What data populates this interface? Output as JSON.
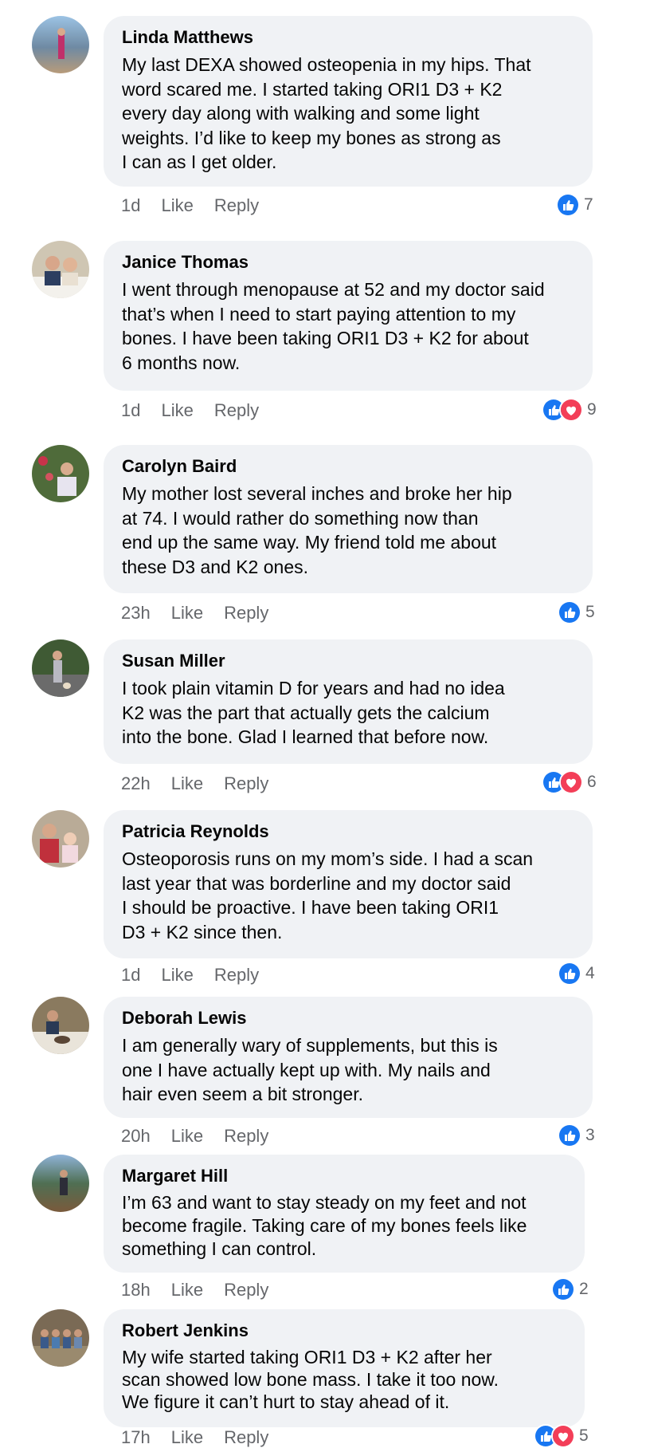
{
  "comments": [
    {
      "author": "Linda Matthews",
      "text": "My last DEXA showed osteopenia in my hips. That word scared me. I started taking ORI1 D3 + K2 every day along with walking and some light weights. I’d like to keep my bones as strong as I can as I get older.",
      "lines": [
        "My last DEXA showed osteopenia in my hips. That",
        "word scared me. I started taking ORI1 D3 + K2",
        "every day along with walking and some light",
        "weights. I’d like to keep my bones as strong as",
        "I can as I get older."
      ],
      "time": "1d",
      "like": "Like",
      "reply": "Reply",
      "reactions": [
        "like-icon"
      ],
      "count": "7"
    },
    {
      "author": "Janice Thomas",
      "text": "",
      "lines": [
        "I went through menopause at 52 and my doctor said",
        "that’s when I need to start paying attention to my",
        "bones. I have been taking ORI1 D3 + K2 for about",
        "6 months now."
      ],
      "time": "1d",
      "like": "Like",
      "reply": "Reply",
      "reactions": [
        "like-icon",
        "love-icon"
      ],
      "count": "9"
    },
    {
      "author": "Carolyn Baird",
      "text": "",
      "lines": [
        "My mother lost several inches and broke her hip",
        "at 74. I would rather do something now than",
        "end up the same way. My friend told me about",
        "these D3 and K2 ones."
      ],
      "time": "23h",
      "like": "Like",
      "reply": "Reply",
      "reactions": [
        "like-icon"
      ],
      "count": "5"
    },
    {
      "author": "Susan Miller",
      "text": "",
      "lines": [
        "I took plain vitamin D for years and had no idea",
        "K2 was the part that actually gets the calcium",
        "into the bone. Glad I learned that before now."
      ],
      "time": "22h",
      "like": "Like",
      "reply": "Reply",
      "reactions": [
        "like-icon",
        "love-icon"
      ],
      "count": "6"
    },
    {
      "author": "Patricia Reynolds",
      "text": "",
      "lines": [
        "Osteoporosis runs on my mom’s side. I had a scan",
        "last year that was borderline and my doctor said",
        "I should be proactive. I have been taking ORI1",
        "D3 + K2 since then."
      ],
      "time": "1d",
      "like": "Like",
      "reply": "Reply",
      "reactions": [
        "like-icon"
      ],
      "count": "4"
    },
    {
      "author": "Deborah Lewis",
      "text": "",
      "lines": [
        "I am generally wary of supplements, but this is",
        "one I have actually kept up with. My nails and",
        "hair even seem a bit stronger."
      ],
      "time": "20h",
      "like": "Like",
      "reply": "Reply",
      "reactions": [
        "like-icon"
      ],
      "count": "3"
    },
    {
      "author": "Margaret Hill",
      "text": "",
      "lines": [
        "I’m 63 and want to stay steady on my feet and not",
        "become fragile. Taking care of my bones feels like",
        "something I can control."
      ],
      "time": "18h",
      "like": "Like",
      "reply": "Reply",
      "reactions": [
        "like-icon"
      ],
      "count": "2"
    },
    {
      "author": "Robert Jenkins",
      "text": "",
      "lines": [
        "My wife started taking ORI1 D3 + K2 after her",
        "scan showed low bone mass. I take it too now.",
        "We figure it can’t hurt to stay ahead of it."
      ],
      "time": "17h",
      "like": "Like",
      "reply": "Reply",
      "reactions": [
        "like-icon",
        "love-icon"
      ],
      "count": "5"
    }
  ],
  "colors": {
    "like": "#1877f2",
    "love": "#f33e58",
    "bubble": "#f0f2f5",
    "meta": "#65676b"
  }
}
